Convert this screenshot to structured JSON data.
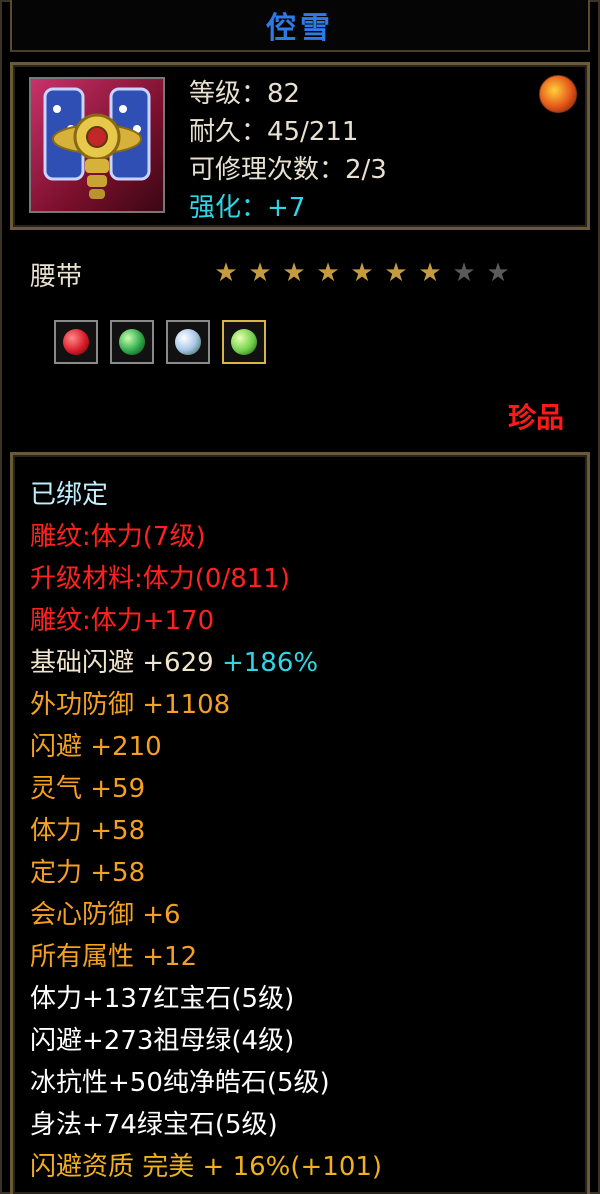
{
  "item": {
    "title": "倥雪",
    "level": "等级：82",
    "durability": "耐久：45/211",
    "repairs": "可修理次数：2/3",
    "enhance": "强化：+7",
    "type": "腰带",
    "rarity": "珍品",
    "stars": {
      "filled": 7,
      "total": 9
    }
  },
  "gems": [
    {
      "icon": "ruby-gem-icon",
      "color": "#d81b2a"
    },
    {
      "icon": "emerald-gem-icon",
      "color": "#2fa84a"
    },
    {
      "icon": "diamond-gem-icon",
      "color": "#cfe8ff"
    },
    {
      "icon": "green-gem-icon",
      "color": "#6fd04a"
    }
  ],
  "props": {
    "bound": "已绑定",
    "engrave1": "雕纹:体力(7级)",
    "upgrade": "升级材料:体力(0/811)",
    "engrave2": "雕纹:体力+170",
    "base_dodge": "基础闪避 +629",
    "base_dodge_pct": "+186%",
    "ext_def": "外功防御 +1108",
    "dodge": "闪避 +210",
    "spirit": "灵气 +59",
    "stamina": "体力 +58",
    "focus": "定力 +58",
    "crit_def": "会心防御 +6",
    "all_attr": "所有属性 +12",
    "gem1": "体力+137红宝石(5级)",
    "gem2": "闪避+273祖母绿(4级)",
    "gem3": "冰抗性+50纯净皓石(5级)",
    "gem4": "身法+74绿宝石(5级)",
    "quality": "闪避资质  完美 + 16%(+101)"
  }
}
